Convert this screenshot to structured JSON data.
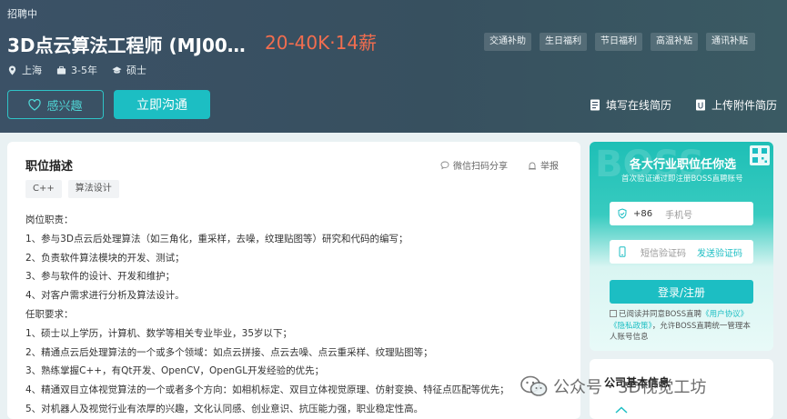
{
  "header": {
    "status": "招聘中",
    "job_title": "3D点云算法工程师 (MJ00…",
    "salary": "20-40K·14薪",
    "tags": [
      "交通补助",
      "生日福利",
      "节日福利",
      "高温补贴",
      "通讯补贴"
    ],
    "meta": {
      "location": "上海",
      "experience": "3-5年",
      "education": "硕士"
    },
    "interest_label": "感兴趣",
    "chat_label": "立即沟通",
    "online_resume_label": "填写在线简历",
    "upload_resume_label": "上传附件简历"
  },
  "job": {
    "section_title": "职位描述",
    "share_label": "微信扫码分享",
    "report_label": "举报",
    "skills": [
      "C++",
      "算法设计"
    ],
    "lines": [
      "岗位职责：",
      "1、参与3D点云后处理算法（如三角化，重采样，去噪，纹理贴图等）研究和代码的编写；",
      "2、负责软件算法模块的开发、测试；",
      "3、参与软件的设计、开发和维护；",
      "4、对客户需求进行分析及算法设计。",
      "任职要求：",
      "1、硕士以上学历，计算机、数学等相关专业毕业，35岁以下；",
      "2、精通点云后处理算法的一个或多个领域：如点云拼接、点云去噪、点云重采样、纹理贴图等；",
      "3、熟练掌握C++，有Qt开发、OpenCV，OpenGL开发经验的优先；",
      "4、精通双目立体视觉算法的一个或者多个方向：如相机标定、双目立体视觉原理、仿射变换、特征点匹配等优先；",
      "5、对机器人及视觉行业有浓厚的兴趣，文化认同感、创业意识、抗压能力强，职业稳定性高。"
    ]
  },
  "login": {
    "watermark": "BOSS",
    "title": "各大行业职位任你选",
    "subtitle": "首次验证通过即注册BOSS直聘账号",
    "country_code": "+86",
    "phone_placeholder": "手机号",
    "code_placeholder": "短信验证码",
    "send_code_label": "发送验证码",
    "submit_label": "登录/注册",
    "agree_prefix": "已阅读并同意BOSS直聘",
    "agree_link1": "《用户协议》",
    "agree_link2": "《隐私政策》",
    "agree_suffix": "，允许BOSS直聘统一管理本人账号信息"
  },
  "company": {
    "title": "公司基本信息"
  },
  "watermark_text": "公众号 · 3D视觉工坊",
  "colors": {
    "accent": "#1cbec3",
    "salary": "#f26d4f",
    "header_bg": "#3b5166"
  }
}
